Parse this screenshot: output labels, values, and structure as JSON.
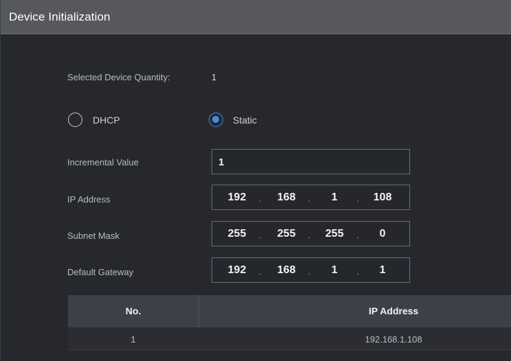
{
  "window": {
    "title": "Device Initialization"
  },
  "form": {
    "quantity_label": "Selected Device Quantity:",
    "quantity_value": "1",
    "mode_options": [
      {
        "label": "DHCP",
        "selected": false
      },
      {
        "label": "Static",
        "selected": true
      }
    ],
    "incremental": {
      "label": "Incremental Value",
      "value": "1"
    },
    "ip_address": {
      "label": "IP Address",
      "octets": [
        "192",
        "168",
        "1",
        "108"
      ]
    },
    "subnet_mask": {
      "label": "Subnet Mask",
      "octets": [
        "255",
        "255",
        "255",
        "0"
      ]
    },
    "gateway": {
      "label": "Default Gateway",
      "octets": [
        "192",
        "168",
        "1",
        "1"
      ]
    },
    "separator": "."
  },
  "table": {
    "columns": [
      "No.",
      "IP Address"
    ],
    "rows": [
      {
        "no": "1",
        "ip": "192.168.1.108"
      }
    ]
  },
  "colors": {
    "accent": "#3d8fe6",
    "titlebar": "#56585d",
    "background": "#26282e"
  }
}
